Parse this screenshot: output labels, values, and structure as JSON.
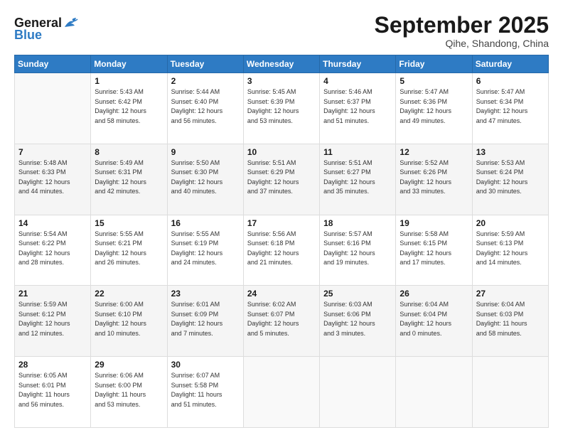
{
  "header": {
    "logo_line1": "General",
    "logo_line2": "Blue",
    "month": "September 2025",
    "location": "Qihe, Shandong, China"
  },
  "days_of_week": [
    "Sunday",
    "Monday",
    "Tuesday",
    "Wednesday",
    "Thursday",
    "Friday",
    "Saturday"
  ],
  "weeks": [
    [
      {
        "day": "",
        "detail": ""
      },
      {
        "day": "1",
        "detail": "Sunrise: 5:43 AM\nSunset: 6:42 PM\nDaylight: 12 hours\nand 58 minutes."
      },
      {
        "day": "2",
        "detail": "Sunrise: 5:44 AM\nSunset: 6:40 PM\nDaylight: 12 hours\nand 56 minutes."
      },
      {
        "day": "3",
        "detail": "Sunrise: 5:45 AM\nSunset: 6:39 PM\nDaylight: 12 hours\nand 53 minutes."
      },
      {
        "day": "4",
        "detail": "Sunrise: 5:46 AM\nSunset: 6:37 PM\nDaylight: 12 hours\nand 51 minutes."
      },
      {
        "day": "5",
        "detail": "Sunrise: 5:47 AM\nSunset: 6:36 PM\nDaylight: 12 hours\nand 49 minutes."
      },
      {
        "day": "6",
        "detail": "Sunrise: 5:47 AM\nSunset: 6:34 PM\nDaylight: 12 hours\nand 47 minutes."
      }
    ],
    [
      {
        "day": "7",
        "detail": "Sunrise: 5:48 AM\nSunset: 6:33 PM\nDaylight: 12 hours\nand 44 minutes."
      },
      {
        "day": "8",
        "detail": "Sunrise: 5:49 AM\nSunset: 6:31 PM\nDaylight: 12 hours\nand 42 minutes."
      },
      {
        "day": "9",
        "detail": "Sunrise: 5:50 AM\nSunset: 6:30 PM\nDaylight: 12 hours\nand 40 minutes."
      },
      {
        "day": "10",
        "detail": "Sunrise: 5:51 AM\nSunset: 6:29 PM\nDaylight: 12 hours\nand 37 minutes."
      },
      {
        "day": "11",
        "detail": "Sunrise: 5:51 AM\nSunset: 6:27 PM\nDaylight: 12 hours\nand 35 minutes."
      },
      {
        "day": "12",
        "detail": "Sunrise: 5:52 AM\nSunset: 6:26 PM\nDaylight: 12 hours\nand 33 minutes."
      },
      {
        "day": "13",
        "detail": "Sunrise: 5:53 AM\nSunset: 6:24 PM\nDaylight: 12 hours\nand 30 minutes."
      }
    ],
    [
      {
        "day": "14",
        "detail": "Sunrise: 5:54 AM\nSunset: 6:22 PM\nDaylight: 12 hours\nand 28 minutes."
      },
      {
        "day": "15",
        "detail": "Sunrise: 5:55 AM\nSunset: 6:21 PM\nDaylight: 12 hours\nand 26 minutes."
      },
      {
        "day": "16",
        "detail": "Sunrise: 5:55 AM\nSunset: 6:19 PM\nDaylight: 12 hours\nand 24 minutes."
      },
      {
        "day": "17",
        "detail": "Sunrise: 5:56 AM\nSunset: 6:18 PM\nDaylight: 12 hours\nand 21 minutes."
      },
      {
        "day": "18",
        "detail": "Sunrise: 5:57 AM\nSunset: 6:16 PM\nDaylight: 12 hours\nand 19 minutes."
      },
      {
        "day": "19",
        "detail": "Sunrise: 5:58 AM\nSunset: 6:15 PM\nDaylight: 12 hours\nand 17 minutes."
      },
      {
        "day": "20",
        "detail": "Sunrise: 5:59 AM\nSunset: 6:13 PM\nDaylight: 12 hours\nand 14 minutes."
      }
    ],
    [
      {
        "day": "21",
        "detail": "Sunrise: 5:59 AM\nSunset: 6:12 PM\nDaylight: 12 hours\nand 12 minutes."
      },
      {
        "day": "22",
        "detail": "Sunrise: 6:00 AM\nSunset: 6:10 PM\nDaylight: 12 hours\nand 10 minutes."
      },
      {
        "day": "23",
        "detail": "Sunrise: 6:01 AM\nSunset: 6:09 PM\nDaylight: 12 hours\nand 7 minutes."
      },
      {
        "day": "24",
        "detail": "Sunrise: 6:02 AM\nSunset: 6:07 PM\nDaylight: 12 hours\nand 5 minutes."
      },
      {
        "day": "25",
        "detail": "Sunrise: 6:03 AM\nSunset: 6:06 PM\nDaylight: 12 hours\nand 3 minutes."
      },
      {
        "day": "26",
        "detail": "Sunrise: 6:04 AM\nSunset: 6:04 PM\nDaylight: 12 hours\nand 0 minutes."
      },
      {
        "day": "27",
        "detail": "Sunrise: 6:04 AM\nSunset: 6:03 PM\nDaylight: 11 hours\nand 58 minutes."
      }
    ],
    [
      {
        "day": "28",
        "detail": "Sunrise: 6:05 AM\nSunset: 6:01 PM\nDaylight: 11 hours\nand 56 minutes."
      },
      {
        "day": "29",
        "detail": "Sunrise: 6:06 AM\nSunset: 6:00 PM\nDaylight: 11 hours\nand 53 minutes."
      },
      {
        "day": "30",
        "detail": "Sunrise: 6:07 AM\nSunset: 5:58 PM\nDaylight: 11 hours\nand 51 minutes."
      },
      {
        "day": "",
        "detail": ""
      },
      {
        "day": "",
        "detail": ""
      },
      {
        "day": "",
        "detail": ""
      },
      {
        "day": "",
        "detail": ""
      }
    ]
  ]
}
